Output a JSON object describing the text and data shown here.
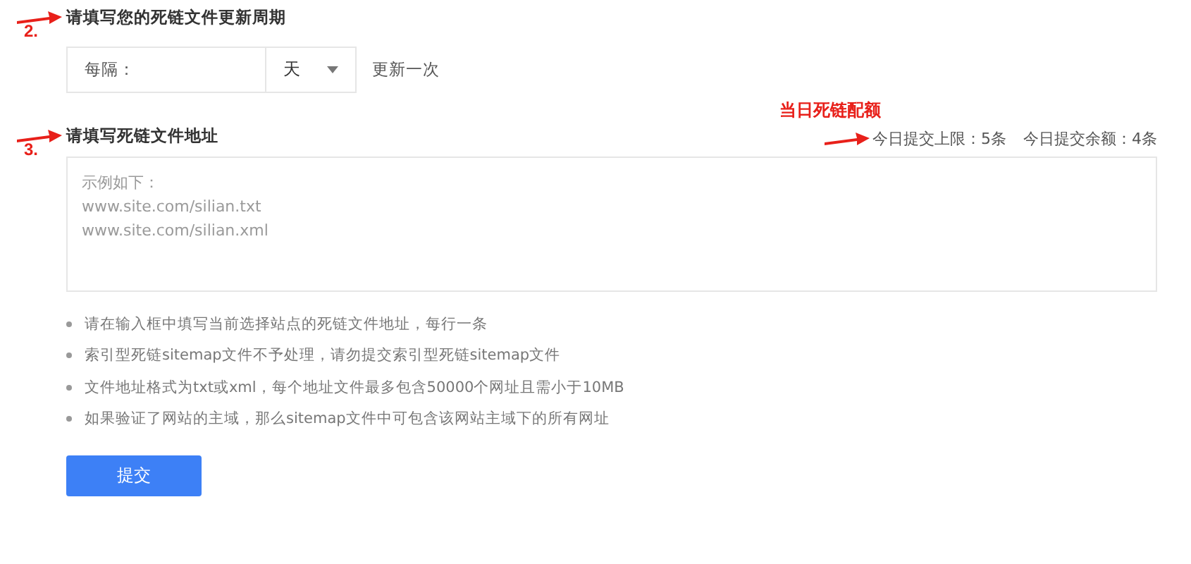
{
  "cycle": {
    "step": "2.",
    "title": "请填写您的死链文件更新周期",
    "interval_label": "每隔：",
    "unit": "天",
    "suffix": "更新一次"
  },
  "files": {
    "step": "3.",
    "title": "请填写死链文件地址",
    "quota_note": "当日死链配额",
    "quota_limit": "今日提交上限：5条",
    "quota_remaining": "今日提交余额：4条",
    "placeholder": "示例如下：\nwww.site.com/silian.txt\nwww.site.com/silian.xml"
  },
  "tips": [
    "请在输入框中填写当前选择站点的死链文件地址，每行一条",
    "索引型死链sitemap文件不予处理，请勿提交索引型死链sitemap文件",
    "文件地址格式为txt或xml，每个地址文件最多包含50000个网址且需小于10MB",
    "如果验证了网站的主域，那么sitemap文件中可包含该网站主域下的所有网址"
  ],
  "submit": "提交"
}
